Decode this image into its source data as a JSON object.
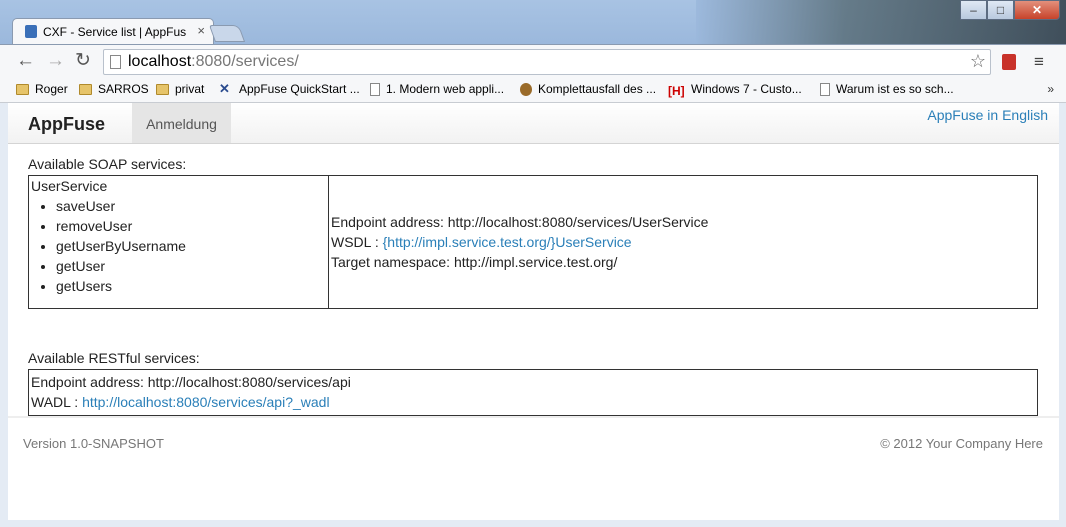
{
  "browser": {
    "tab_title": "CXF - Service list | AppFus",
    "tab_close": "×",
    "url_host": "localhost",
    "url_rest": ":8080/services/",
    "back": "←",
    "forward": "→",
    "reload": "↻",
    "star": "☆",
    "menu": "≡",
    "window": {
      "minimize": "–",
      "maximize": "□",
      "close": "✕"
    },
    "bookmarks": [
      {
        "label": "Roger",
        "icon": "folder-icon"
      },
      {
        "label": "SARROS",
        "icon": "folder-icon"
      },
      {
        "label": "privat",
        "icon": "folder-icon"
      },
      {
        "label": "AppFuse QuickStart ...",
        "icon": "appfuse-icon"
      },
      {
        "label": "1. Modern web appli...",
        "icon": "page-icon"
      },
      {
        "label": "Komplettausfall des ...",
        "icon": "owl-icon"
      },
      {
        "label": "Windows 7 - Custo...",
        "icon": "heise-icon"
      },
      {
        "label": "Warum ist es so sch...",
        "icon": "page-icon"
      }
    ],
    "bookmarks_more": "»"
  },
  "page": {
    "brand": "AppFuse",
    "nav_login": "Anmeldung",
    "lang_link": "AppFuse in English",
    "soap_heading": "Available SOAP services:",
    "soap_service": {
      "name": "UserService",
      "operations": [
        "saveUser",
        "removeUser",
        "getUserByUsername",
        "getUser",
        "getUsers"
      ],
      "endpoint_label": "Endpoint address: ",
      "endpoint": "http://localhost:8080/services/UserService",
      "wsdl_label": "WSDL : ",
      "wsdl": "{http://impl.service.test.org/}UserService",
      "ns_label": "Target namespace: ",
      "ns": "http://impl.service.test.org/"
    },
    "rest_heading": "Available RESTful services:",
    "rest_service": {
      "endpoint_label": "Endpoint address: ",
      "endpoint": "http://localhost:8080/services/api",
      "wadl_label": "WADL : ",
      "wadl": "http://localhost:8080/services/api?_wadl"
    },
    "footer_version": "Version 1.0-SNAPSHOT",
    "footer_copyright": "© 2012  Your Company Here"
  }
}
